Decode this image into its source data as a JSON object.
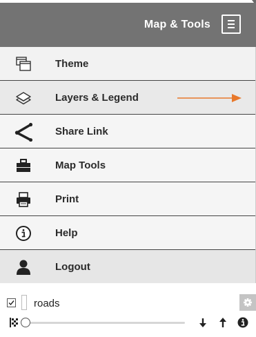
{
  "header": {
    "title": "Map & Tools",
    "menu_icon": "hamburger-menu-icon",
    "background_color": "#737373"
  },
  "menu": {
    "items": [
      {
        "label": "Theme",
        "icon": "theme-windows-icon"
      },
      {
        "label": "Layers & Legend",
        "icon": "layers-icon"
      },
      {
        "label": "Share Link",
        "icon": "share-icon"
      },
      {
        "label": "Map Tools",
        "icon": "toolbox-icon"
      },
      {
        "label": "Print",
        "icon": "printer-icon"
      },
      {
        "label": "Help",
        "icon": "info-circle-icon"
      },
      {
        "label": "Logout",
        "icon": "user-silhouette-icon"
      }
    ],
    "pointer_arrow_color": "#e8782a"
  },
  "layer": {
    "checked": true,
    "name": "roads",
    "opacity_level": 0,
    "icons": [
      "gear-icon",
      "legend-flag-icon",
      "move-down-icon",
      "move-up-icon",
      "info-icon"
    ]
  }
}
